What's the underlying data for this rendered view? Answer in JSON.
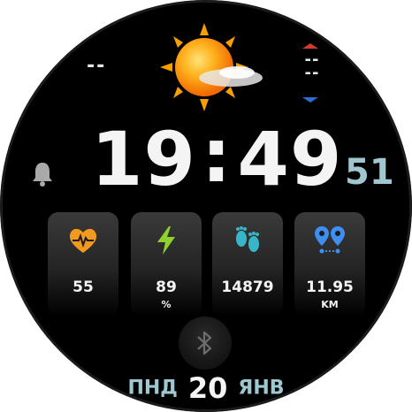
{
  "weather": {
    "left_value": "--",
    "icon": "sun-with-cloud-icon",
    "temp_high_color": "#d23b2b",
    "temp_low_color": "#2b6dd2",
    "temp_value": "--\n--"
  },
  "time": {
    "hours": "19",
    "separator": ":",
    "minutes": "49",
    "seconds": "51"
  },
  "alarm": {
    "icon": "bell-icon"
  },
  "tiles": [
    {
      "icon": "heart-rate-icon",
      "value": "55",
      "unit": "",
      "color": "#f29a1f"
    },
    {
      "icon": "lightning-icon",
      "value": "89",
      "unit": "%",
      "color": "#8fd12e"
    },
    {
      "icon": "footprints-icon",
      "value": "14879",
      "unit": "",
      "color": "#37b5c9"
    },
    {
      "icon": "distance-pins-icon",
      "value": "11.95",
      "unit": "KM",
      "color": "#3f8ff2"
    }
  ],
  "bluetooth": {
    "icon": "bluetooth-icon"
  },
  "date": {
    "weekday": "ПНД",
    "day": "20",
    "month": "ЯНВ"
  }
}
